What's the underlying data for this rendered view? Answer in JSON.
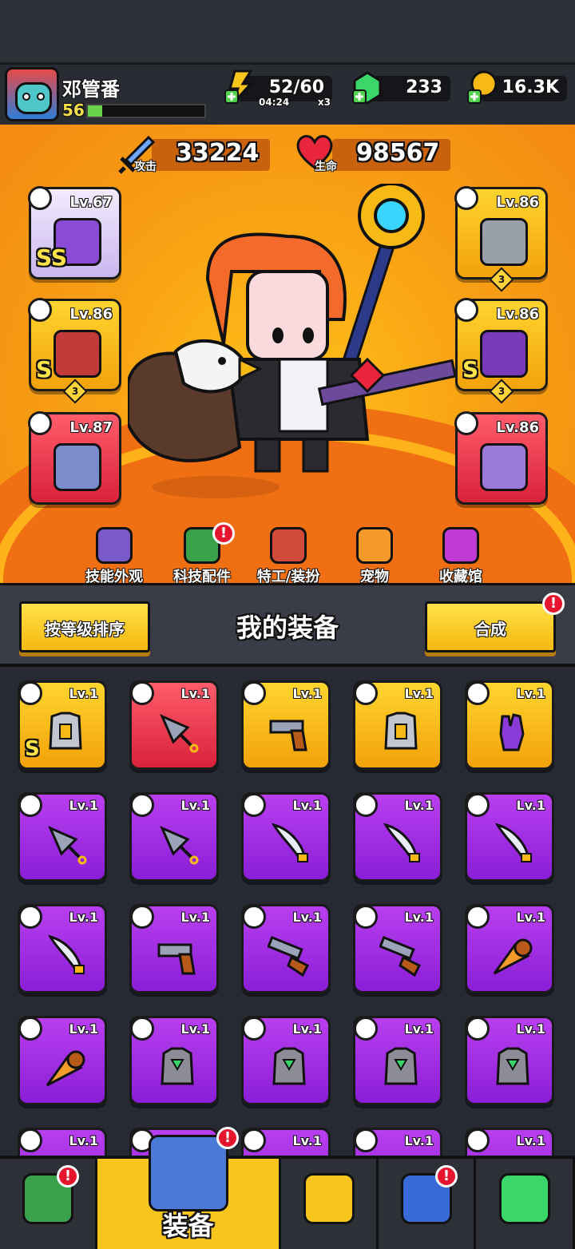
{
  "player": {
    "name": "邓管番",
    "level": "56",
    "xp_fraction": 0.12
  },
  "resources": {
    "energy": {
      "value": "52/60",
      "timer": "04:24",
      "multiplier": "x3"
    },
    "gems": {
      "value": "233"
    },
    "coins": {
      "value": "16.3K"
    }
  },
  "stats": {
    "attack": {
      "value": "33224",
      "label": "攻击"
    },
    "hp": {
      "value": "98567",
      "label": "生命"
    }
  },
  "equipped": [
    {
      "slot": "weapon",
      "level": "Lv.67",
      "rank": "SS",
      "stars": "",
      "color": "lilac"
    },
    {
      "slot": "necklace",
      "level": "Lv.86",
      "rank": "S",
      "stars": "3",
      "color": "gold"
    },
    {
      "slot": "gloves",
      "level": "Lv.87",
      "rank": "",
      "stars": "",
      "color": "red"
    },
    {
      "slot": "armor",
      "level": "Lv.86",
      "rank": "",
      "stars": "3",
      "color": "gold"
    },
    {
      "slot": "belt",
      "level": "Lv.86",
      "rank": "S",
      "stars": "3",
      "color": "gold"
    },
    {
      "slot": "boots",
      "level": "Lv.86",
      "rank": "",
      "stars": "",
      "color": "red"
    }
  ],
  "nav": [
    {
      "label": "技能外观",
      "badge": false
    },
    {
      "label": "科技配件",
      "badge": true
    },
    {
      "label": "特工/装扮",
      "badge": false
    },
    {
      "label": "宠物",
      "badge": false
    },
    {
      "label": "收藏馆",
      "badge": false
    }
  ],
  "inventory": {
    "sort_label": "按等级排序",
    "title": "我的装备",
    "merge_label": "合成",
    "badge": "!",
    "items": [
      {
        "level": "Lv.1",
        "color": "gold",
        "kind": "armor",
        "rank": "S"
      },
      {
        "level": "Lv.1",
        "color": "red",
        "kind": "kunai",
        "rank": ""
      },
      {
        "level": "Lv.1",
        "color": "gold",
        "kind": "revolver",
        "rank": ""
      },
      {
        "level": "Lv.1",
        "color": "gold",
        "kind": "armor",
        "rank": ""
      },
      {
        "level": "Lv.1",
        "color": "gold",
        "kind": "gloves",
        "rank": ""
      },
      {
        "level": "Lv.1",
        "color": "purple",
        "kind": "kunai",
        "rank": ""
      },
      {
        "level": "Lv.1",
        "color": "purple",
        "kind": "kunai",
        "rank": ""
      },
      {
        "level": "Lv.1",
        "color": "purple",
        "kind": "sword",
        "rank": ""
      },
      {
        "level": "Lv.1",
        "color": "purple",
        "kind": "sword",
        "rank": ""
      },
      {
        "level": "Lv.1",
        "color": "purple",
        "kind": "sword",
        "rank": ""
      },
      {
        "level": "Lv.1",
        "color": "purple",
        "kind": "sword",
        "rank": ""
      },
      {
        "level": "Lv.1",
        "color": "purple",
        "kind": "revolver",
        "rank": ""
      },
      {
        "level": "Lv.1",
        "color": "purple",
        "kind": "shotgun",
        "rank": ""
      },
      {
        "level": "Lv.1",
        "color": "purple",
        "kind": "shotgun",
        "rank": ""
      },
      {
        "level": "Lv.1",
        "color": "purple",
        "kind": "drill",
        "rank": ""
      },
      {
        "level": "Lv.1",
        "color": "purple",
        "kind": "drill",
        "rank": ""
      },
      {
        "level": "Lv.1",
        "color": "purple",
        "kind": "vest",
        "rank": ""
      },
      {
        "level": "Lv.1",
        "color": "purple",
        "kind": "vest",
        "rank": ""
      },
      {
        "level": "Lv.1",
        "color": "purple",
        "kind": "vest",
        "rank": ""
      },
      {
        "level": "Lv.1",
        "color": "purple",
        "kind": "vest",
        "rank": ""
      },
      {
        "level": "Lv.1",
        "color": "purple",
        "kind": "vest",
        "rank": ""
      },
      {
        "level": "Lv.1",
        "color": "purple",
        "kind": "vest",
        "rank": ""
      },
      {
        "level": "Lv.1",
        "color": "purple",
        "kind": "vest",
        "rank": ""
      },
      {
        "level": "Lv.1",
        "color": "purple",
        "kind": "vest",
        "rank": ""
      },
      {
        "level": "Lv.1",
        "color": "purple",
        "kind": "vest",
        "rank": ""
      }
    ]
  },
  "tabs": [
    {
      "name": "shop",
      "label": "",
      "badge": true
    },
    {
      "name": "equipment",
      "label": "装备",
      "badge": true
    },
    {
      "name": "battle",
      "label": "",
      "badge": false
    },
    {
      "name": "talents",
      "label": "",
      "badge": true
    },
    {
      "name": "evolution",
      "label": "",
      "badge": false
    }
  ],
  "colors": {
    "gold": "#f7c51c",
    "red": "#e8334a",
    "purple": "#9b2ee0",
    "lilac": "#e6dcff"
  }
}
